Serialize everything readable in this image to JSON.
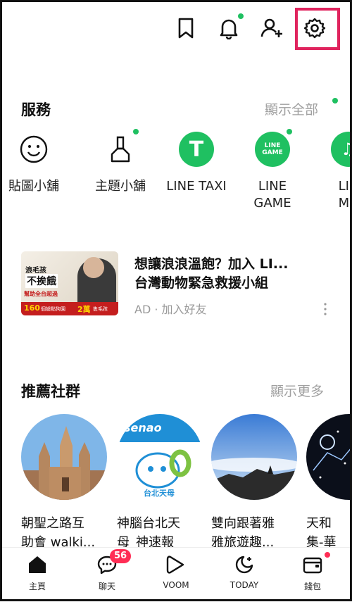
{
  "colors": {
    "accent_green": "#1fc061",
    "highlight_red": "#e0245e",
    "badge_red": "#ff2d55",
    "muted": "#a0a0a0"
  },
  "top_bar": {
    "icons": [
      "bookmark-icon",
      "bell-icon",
      "add-friend-icon",
      "gear-icon"
    ]
  },
  "services": {
    "title": "服務",
    "show_all": "顯示全部",
    "items": [
      {
        "label": "貼圖小舖",
        "icon": "smiley-icon"
      },
      {
        "label": "主題小舖",
        "icon": "brush-icon"
      },
      {
        "label": "LINE TAXI",
        "icon": "taxi-icon",
        "glyph": "T"
      },
      {
        "label": "LINE\nGAME",
        "icon": "line-game-icon",
        "glyph": "LINE\nGAME"
      },
      {
        "label": "LIN\nMU",
        "icon": "music-icon",
        "glyph": "♫"
      }
    ]
  },
  "ad": {
    "title": "想讓浪浪溫飽？加入 LI...\n台灣動物緊急救援小組",
    "subtitle": "AD · 加入好友",
    "thumb_lines": [
      "浪毛孩",
      "不挨餓",
      "幫助全台超過",
      "160",
      "個據點狗園",
      "2萬",
      "隻毛孩"
    ]
  },
  "communities": {
    "title": "推薦社群",
    "show_more": "顯示更多",
    "items": [
      {
        "name": "朝聖之路互\n助會 walki..."
      },
      {
        "name": "神腦台北天\n母_神速報",
        "img_text": "senao",
        "img_caption": "台北天母"
      },
      {
        "name": "雙向跟著雅\n雅旅遊趣..."
      },
      {
        "name": "天和\n集-華"
      }
    ]
  },
  "bottom_nav": [
    {
      "label": "主頁",
      "icon": "home-icon"
    },
    {
      "label": "聊天",
      "icon": "chat-icon",
      "badge": "56"
    },
    {
      "label": "VOOM",
      "icon": "voom-icon"
    },
    {
      "label": "TODAY",
      "icon": "today-icon"
    },
    {
      "label": "錢包",
      "icon": "wallet-icon"
    }
  ]
}
